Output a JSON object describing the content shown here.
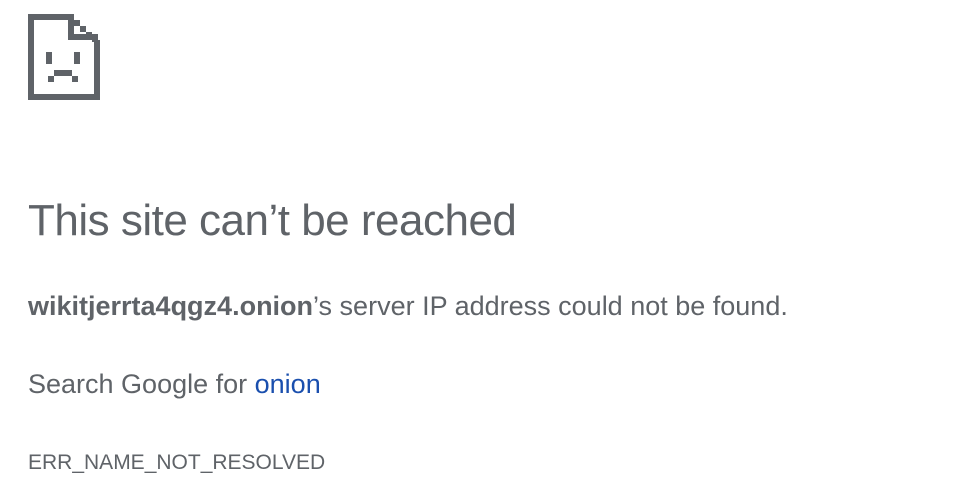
{
  "icon": {
    "name": "sad-page-icon",
    "color": "#5f6368"
  },
  "title": "This site can’t be reached",
  "message": {
    "host": "wikitjerrta4qgz4.onion",
    "text": "’s server IP address could not be found."
  },
  "search": {
    "prefix": "Search Google for ",
    "link_text": "onion",
    "link_color": "#1a4fae"
  },
  "error_code": "ERR_NAME_NOT_RESOLVED"
}
